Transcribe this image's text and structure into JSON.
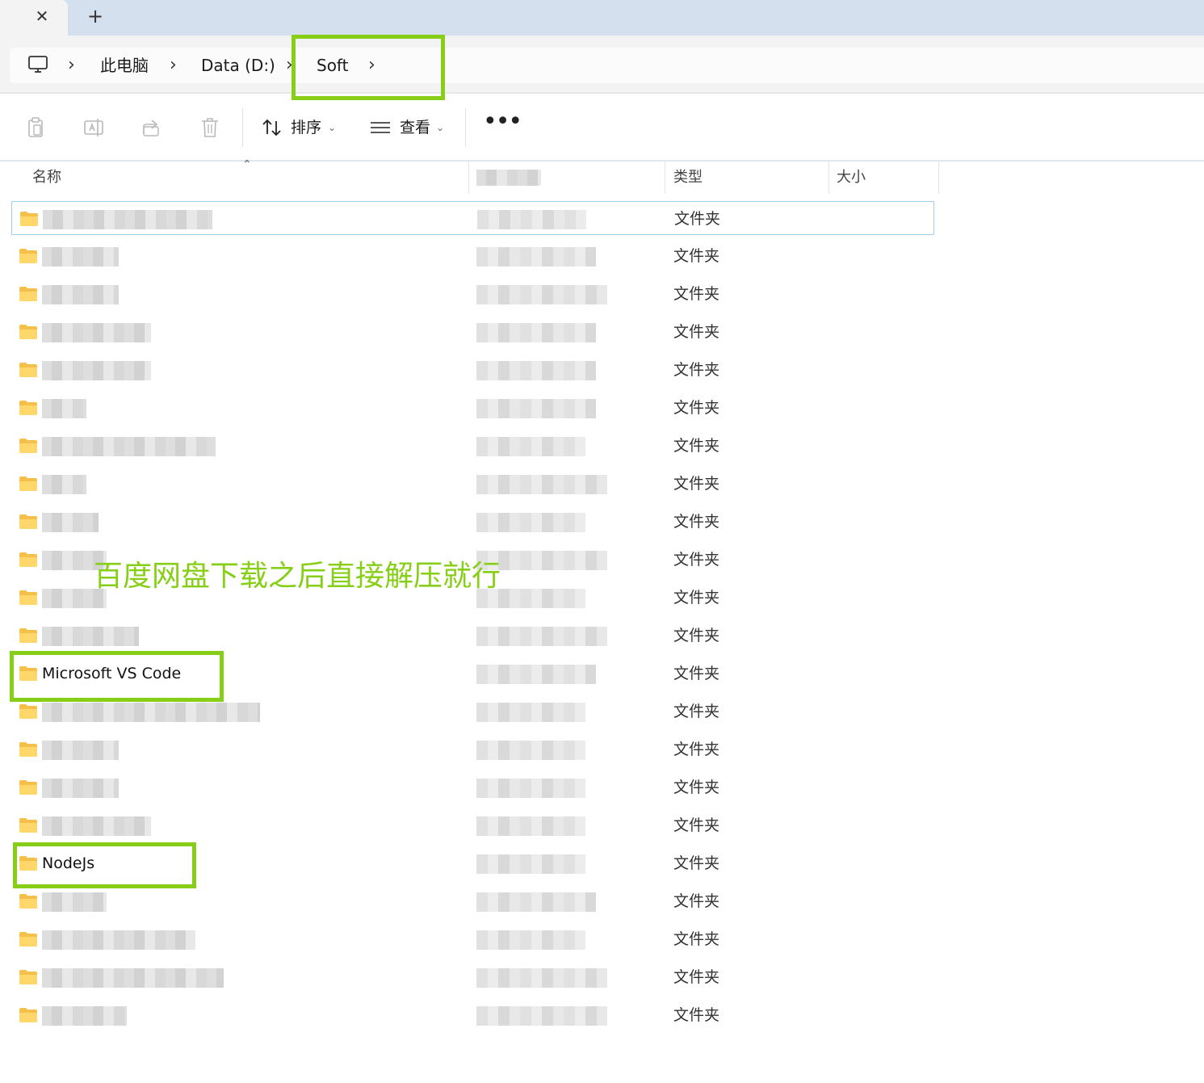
{
  "tabstrip": {
    "close_icon": "close-icon",
    "new_tab_icon": "plus-icon"
  },
  "address": {
    "crumbs": [
      "此电脑",
      "Data (D:)",
      "Soft"
    ],
    "pc_icon": "monitor-icon",
    "chevron": "›"
  },
  "toolbar": {
    "sort_label": "排序",
    "view_label": "查看",
    "dropdown_glyph": "⌄",
    "more_glyph": "•••",
    "icons": [
      "paste-icon",
      "rename-icon",
      "share-icon",
      "delete-icon"
    ]
  },
  "columns": {
    "name": "名称",
    "type": "类型",
    "size": "大小"
  },
  "rows": [
    {
      "type": "文件夹"
    },
    {
      "type": "文件夹"
    },
    {
      "type": "文件夹"
    },
    {
      "type": "文件夹"
    },
    {
      "type": "文件夹"
    },
    {
      "type": "文件夹"
    },
    {
      "type": "文件夹"
    },
    {
      "type": "文件夹"
    },
    {
      "type": "文件夹"
    },
    {
      "type": "文件夹"
    },
    {
      "type": "文件夹"
    },
    {
      "type": "文件夹"
    },
    {
      "name": "Microsoft VS Code",
      "type": "文件夹"
    },
    {
      "type": "文件夹"
    },
    {
      "type": "文件夹"
    },
    {
      "type": "文件夹"
    },
    {
      "type": "文件夹"
    },
    {
      "name": "NodeJs",
      "type": "文件夹"
    },
    {
      "type": "文件夹"
    },
    {
      "type": "文件夹"
    },
    {
      "type": "文件夹"
    },
    {
      "type": "文件夹"
    }
  ],
  "annotation": {
    "text": "百度网盘下载之后直接解压就行",
    "color": "#86cf16"
  }
}
